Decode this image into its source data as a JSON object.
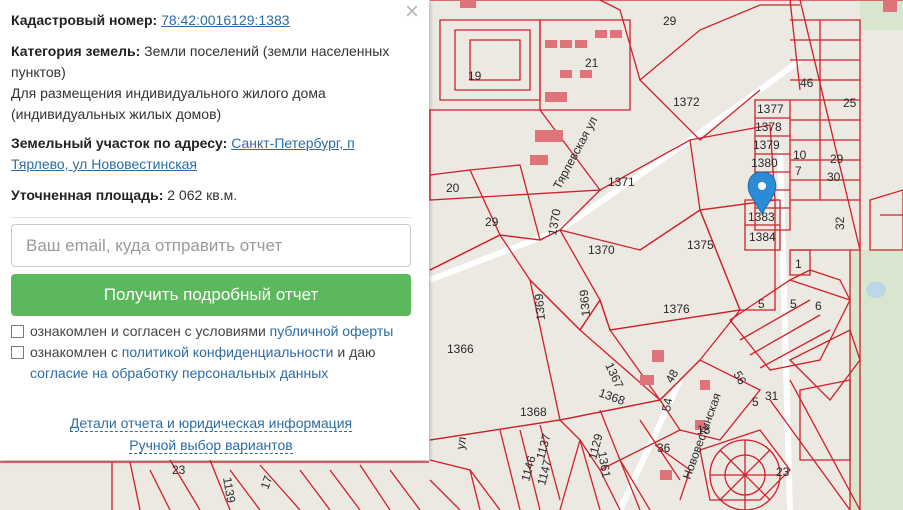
{
  "info": {
    "cadastral_label": "Кадастровый номер:",
    "cadastral_number": "78:42:0016129:1383",
    "category_label": "Категория земель:",
    "category_value": "Земли поселений (земли населенных пунктов)",
    "usage": "Для размещения индивидуального жилого дома (индивидуальных жилых домов)",
    "address_label": "Земельный участок по адресу:",
    "address_value": "Санкт-Петербург, п Тярлево, ул Нововестинская",
    "area_label": "Уточненная площадь:",
    "area_value": "2 062 кв.м."
  },
  "form": {
    "email_placeholder": "Ваш email, куда отправить отчет",
    "submit_label": "Получить подробный отчет",
    "consent1_text": "ознакомлен и согласен с условиями ",
    "consent1_link": "публичной оферты",
    "consent2_text_a": "ознакомлен с ",
    "consent2_link_a": "политикой конфиденциальности",
    "consent2_text_b": " и даю ",
    "consent2_link_b": "согласие на обработку персональных данных"
  },
  "footer": {
    "details_link": "Детали отчета и юридическая информация",
    "manual_link": "Ручной выбор вариантов"
  },
  "close_icon": "×",
  "map": {
    "line_color": "#d0202a",
    "parcel_labels": {
      "p29_top": "29",
      "p19": "19",
      "p21": "21",
      "p46": "46",
      "p25": "25",
      "p1372": "1372",
      "p1377": "1377",
      "p1378": "1378",
      "p1379": "1379",
      "p1380": "1380",
      "p10": "10",
      "p29b": "29",
      "p7": "7",
      "p30": "30",
      "p1371": "1371",
      "p20": "20",
      "p29c": "29",
      "p1370v": "1370",
      "p1370": "1370",
      "p1375": "1375",
      "p1383": "1383",
      "p1384": "1384",
      "p32": "32",
      "p1": "1",
      "p1369v": "1369",
      "p1369b": "1369",
      "p1366": "1366",
      "p1376": "1376",
      "p5": "5",
      "p5b": "5",
      "p6": "6",
      "p1367": "1367",
      "p48": "48",
      "p56": "56",
      "p1368": "1368",
      "p1368b": "1368",
      "p54": "54",
      "p18": "18",
      "p5c": "5",
      "p31": "31",
      "p1137": "1137",
      "p1129": "1129",
      "p1146": "1146",
      "p1147": "1147",
      "p1361": "1361",
      "p36": "36",
      "p23": "23",
      "p23b": "23",
      "p1139": "1139",
      "p17": "17"
    },
    "street_labels": {
      "s1": "Тярлевская ул",
      "s2": "Нововестинская",
      "s3": "ул"
    },
    "marker_icon": "map-pin-icon",
    "marker_color": "#2b8bd6"
  }
}
